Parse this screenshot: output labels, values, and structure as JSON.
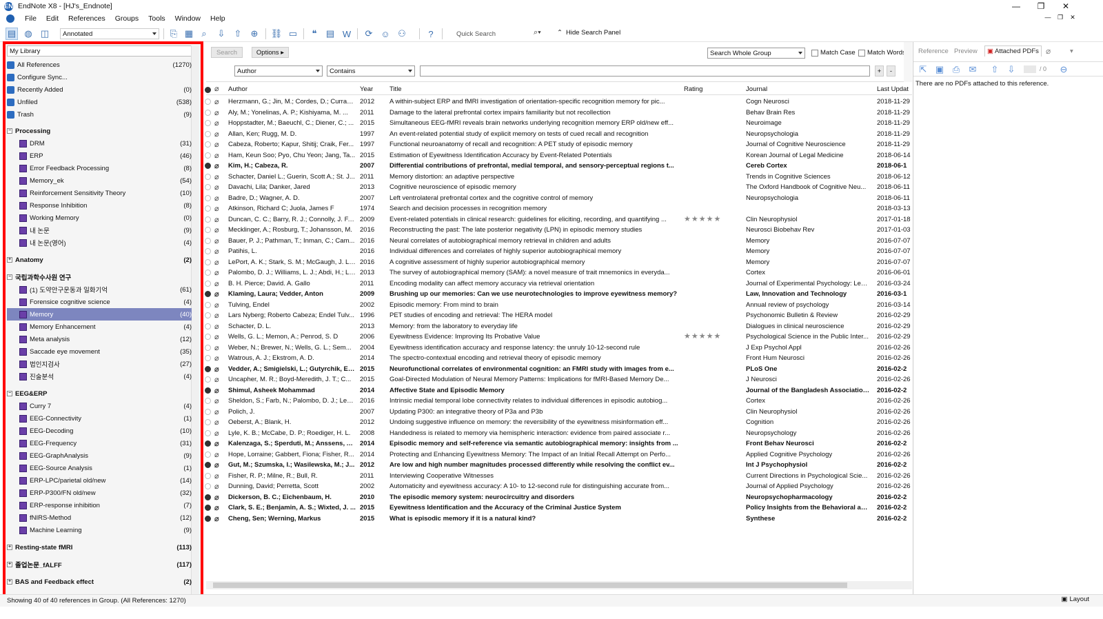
{
  "window": {
    "title": "EndNote X8 - [HJ's_Endnote]",
    "app_icon": "EN"
  },
  "window_controls": {
    "minimize": "—",
    "restore": "❐",
    "close": "✕"
  },
  "menu": [
    "File",
    "Edit",
    "References",
    "Groups",
    "Tools",
    "Window",
    "Help"
  ],
  "toolbar": {
    "style_value": "Annotated",
    "quick_search_placeholder": "Quick Search",
    "hide_search_label": "Hide Search Panel"
  },
  "library": {
    "header": "My Library",
    "items": [
      {
        "label": "All References",
        "count": "(1270)",
        "icon": "all-references-icon"
      },
      {
        "label": "Configure Sync...",
        "count": "",
        "icon": "sync-icon"
      },
      {
        "label": "Recently Added",
        "count": "(0)",
        "icon": "clock-icon"
      },
      {
        "label": "Unfiled",
        "count": "(538)",
        "icon": "unfiled-icon"
      },
      {
        "label": "Trash",
        "count": "(9)",
        "icon": "trash-icon"
      }
    ],
    "group_sets": [
      {
        "name": "Processing",
        "expanded": true,
        "groups": [
          {
            "label": "DRM",
            "count": "(31)"
          },
          {
            "label": "ERP",
            "count": "(46)"
          },
          {
            "label": "Error Feedback Processing",
            "count": "(8)"
          },
          {
            "label": "Memory_ek",
            "count": "(54)"
          },
          {
            "label": "Reinforcement Sensitivity Theory",
            "count": "(10)"
          },
          {
            "label": "Response Inhibition",
            "count": "(8)"
          },
          {
            "label": "Working Memory",
            "count": "(0)"
          },
          {
            "label": "내 논문",
            "count": "(9)"
          },
          {
            "label": "내 논문(영어)",
            "count": "(4)"
          }
        ]
      },
      {
        "name": "Anatomy",
        "expanded": false,
        "count": "(2)",
        "groups": []
      },
      {
        "name": "국립과학수사원 연구",
        "expanded": true,
        "groups": [
          {
            "label": "(1) 도약안구운동과 일화기억",
            "count": "(61)"
          },
          {
            "label": "Forensice cognitive science",
            "count": "(4)"
          },
          {
            "label": "Memory",
            "count": "(40)",
            "selected": true
          },
          {
            "label": "Memory Enhancement",
            "count": "(4)"
          },
          {
            "label": "Meta analysis",
            "count": "(12)"
          },
          {
            "label": "Saccade eye movement",
            "count": "(35)"
          },
          {
            "label": "법인지검사",
            "count": "(27)"
          },
          {
            "label": "진술분석",
            "count": "(4)"
          }
        ]
      },
      {
        "name": "EEG&ERP",
        "expanded": true,
        "groups": [
          {
            "label": "Curry 7",
            "count": "(4)"
          },
          {
            "label": "EEG-Connectivity",
            "count": "(1)"
          },
          {
            "label": "EEG-Decoding",
            "count": "(10)"
          },
          {
            "label": "EEG-Frequency",
            "count": "(31)"
          },
          {
            "label": "EEG-GraphAnalysis",
            "count": "(9)"
          },
          {
            "label": "EEG-Source Analysis",
            "count": "(1)"
          },
          {
            "label": "ERP-LPC/parietal old/new",
            "count": "(14)"
          },
          {
            "label": "ERP-P300/FN old/new",
            "count": "(32)"
          },
          {
            "label": "ERP-response inhibition",
            "count": "(7)"
          },
          {
            "label": "fNIRS-Method",
            "count": "(12)"
          },
          {
            "label": "Machine Learning",
            "count": "(9)"
          }
        ]
      },
      {
        "name": "Resting-state fMRI",
        "expanded": false,
        "count": "(113)",
        "groups": []
      },
      {
        "name": "졸업논문_fALFF",
        "expanded": false,
        "count": "(117)",
        "groups": []
      },
      {
        "name": "BAS and Feedback effect",
        "expanded": false,
        "count": "(2)",
        "groups": []
      }
    ]
  },
  "search_panel": {
    "search_label": "Search",
    "options_label": "Options ▸",
    "scope_value": "Search Whole Group",
    "match_case": "Match Case",
    "match_words": "Match Words",
    "field_value": "Author",
    "operator_value": "Contains",
    "plus": "+",
    "minus": "-"
  },
  "columns": {
    "author": "Author",
    "year": "Year",
    "title": "Title",
    "rating": "Rating",
    "journal": "Journal",
    "updated": "Last Updat"
  },
  "references": [
    {
      "author": "Herzmann, G.; Jin, M.; Cordes, D.; Curran...",
      "year": "2012",
      "title": "A within-subject ERP and fMRI investigation of orientation-specific recognition memory for pic...",
      "rating": "",
      "journal": "Cogn Neurosci",
      "updated": "2018-11-29",
      "bold": false
    },
    {
      "author": "Aly, M.; Yonelinas, A. P.; Kishiyama, M. ...",
      "year": "2011",
      "title": "Damage to the lateral prefrontal cortex impairs familiarity but not recollection",
      "rating": "",
      "journal": "Behav Brain Res",
      "updated": "2018-11-29",
      "bold": false
    },
    {
      "author": "Hoppstadter, M.; Baeuchl, C.; Diener, C.; ...",
      "year": "2015",
      "title": "Simultaneous EEG-fMRI reveals brain networks underlying recognition memory ERP old/new eff...",
      "rating": "",
      "journal": "Neuroimage",
      "updated": "2018-11-29",
      "bold": false
    },
    {
      "author": "Allan, Ken; Rugg, M. D.",
      "year": "1997",
      "title": "An event-related potential study of explicit memory on tests of cued recall and recognition",
      "rating": "",
      "journal": "Neuropsychologia",
      "updated": "2018-11-29",
      "bold": false
    },
    {
      "author": "Cabeza, Roberto; Kapur, Shitij; Craik, Fer...",
      "year": "1997",
      "title": "Functional neuroanatomy of recall and recognition: A PET study of episodic memory",
      "rating": "",
      "journal": "Journal of Cognitive Neuroscience",
      "updated": "2018-11-29",
      "bold": false
    },
    {
      "author": "Ham, Keun Soo; Pyo, Chu Yeon; Jang, Ta...",
      "year": "2015",
      "title": "Estimation of Eyewitness Identification Accuracy by Event-Related Potentials",
      "rating": "",
      "journal": "Korean Journal of Legal Medicine",
      "updated": "2018-06-14",
      "bold": false
    },
    {
      "author": "Kim, H.; Cabeza, R.",
      "year": "2007",
      "title": "Differential contributions of prefrontal, medial temporal, and sensory-perceptual regions t...",
      "rating": "",
      "journal": "Cereb Cortex",
      "updated": "2018-06-1",
      "bold": true
    },
    {
      "author": "Schacter, Daniel L.; Guerin, Scott A.; St. J...",
      "year": "2011",
      "title": "Memory distortion: an adaptive perspective",
      "rating": "",
      "journal": "Trends in Cognitive Sciences",
      "updated": "2018-06-12",
      "bold": false
    },
    {
      "author": "Davachi, Lila; Danker, Jared",
      "year": "2013",
      "title": "Cognitive neuroscience of episodic memory",
      "rating": "",
      "journal": "The Oxford Handbook of Cognitive Neu...",
      "updated": "2018-06-11",
      "bold": false
    },
    {
      "author": "Badre, D.; Wagner, A. D.",
      "year": "2007",
      "title": "Left ventrolateral prefrontal cortex and the cognitive control of memory",
      "rating": "",
      "journal": "Neuropsychologia",
      "updated": "2018-06-11",
      "bold": false
    },
    {
      "author": "Atkinson, Richard C; Juola, James F",
      "year": "1974",
      "title": "Search and decision processes in recognition memory",
      "rating": "",
      "journal": "",
      "updated": "2018-03-13",
      "bold": false
    },
    {
      "author": "Duncan, C. C.; Barry, R. J.; Connolly, J. F.;...",
      "year": "2009",
      "title": "Event-related potentials in clinical research: guidelines for eliciting, recording, and quantifying ...",
      "rating": "★★★★★",
      "journal": "Clin Neurophysiol",
      "updated": "2017-01-18",
      "bold": false
    },
    {
      "author": "Mecklinger, A.; Rosburg, T.; Johansson, M.",
      "year": "2016",
      "title": "Reconstructing the past: The late posterior negativity (LPN) in episodic memory studies",
      "rating": "",
      "journal": "Neurosci Biobehav Rev",
      "updated": "2017-01-03",
      "bold": false
    },
    {
      "author": "Bauer, P. J.; Pathman, T.; Inman, C.; Cam...",
      "year": "2016",
      "title": "Neural correlates of autobiographical memory retrieval in children and adults",
      "rating": "",
      "journal": "Memory",
      "updated": "2016-07-07",
      "bold": false
    },
    {
      "author": "Patihis, L.",
      "year": "2016",
      "title": "Individual differences and correlates of highly superior autobiographical memory",
      "rating": "",
      "journal": "Memory",
      "updated": "2016-07-07",
      "bold": false
    },
    {
      "author": "LePort, A. K.; Stark, S. M.; McGaugh, J. L.;...",
      "year": "2016",
      "title": "A cognitive assessment of highly superior autobiographical memory",
      "rating": "",
      "journal": "Memory",
      "updated": "2016-07-07",
      "bold": false
    },
    {
      "author": "Palombo, D. J.; Williams, L. J.; Abdi, H.; Le...",
      "year": "2013",
      "title": "The survey of autobiographical memory (SAM): a novel measure of trait mnemonics in everyda...",
      "rating": "",
      "journal": "Cortex",
      "updated": "2016-06-01",
      "bold": false
    },
    {
      "author": "B. H. Pierce; David. A. Gallo",
      "year": "2011",
      "title": "Encoding modality can affect memory accuracy via retrieval orientation",
      "rating": "",
      "journal": "Journal of Experimental Psychology: Lea...",
      "updated": "2016-03-24",
      "bold": false
    },
    {
      "author": "Klaming, Laura; Vedder, Anton",
      "year": "2009",
      "title": "Brushing up our memories: Can we use neurotechnologies to improve eyewitness memory?",
      "rating": "",
      "journal": "Law, Innovation and Technology",
      "updated": "2016-03-1",
      "bold": true
    },
    {
      "author": "Tulving, Endel",
      "year": "2002",
      "title": "Episodic memory: From mind to brain",
      "rating": "",
      "journal": "Annual review of psychology",
      "updated": "2016-03-14",
      "bold": false
    },
    {
      "author": "Lars Nyberg; Roberto Cabeza; Endel Tulv...",
      "year": "1996",
      "title": "PET studies of encoding and retrieval: The HERA model",
      "rating": "",
      "journal": "Psychonomic Bulletin & Review",
      "updated": "2016-02-29",
      "bold": false
    },
    {
      "author": "Schacter, D. L.",
      "year": "2013",
      "title": "Memory: from the laboratory to everyday life",
      "rating": "",
      "journal": "Dialogues in clinical neuroscience",
      "updated": "2016-02-29",
      "bold": false
    },
    {
      "author": "Wells, G. L.; Memon, A.; Penrod, S. D",
      "year": "2006",
      "title": "Eyewitness Evidence: Improving Its Probative Value",
      "rating": "★★★★★",
      "journal": "Psychological Science in the Public Inter...",
      "updated": "2016-02-29",
      "bold": false
    },
    {
      "author": "Weber, N.; Brewer, N.; Wells, G. L.; Sem...",
      "year": "2004",
      "title": "Eyewitness identification accuracy and response latency: the unruly 10-12-second rule",
      "rating": "",
      "journal": "J Exp Psychol Appl",
      "updated": "2016-02-26",
      "bold": false
    },
    {
      "author": "Watrous, A. J.; Ekstrom, A. D.",
      "year": "2014",
      "title": "The spectro-contextual encoding and retrieval theory of episodic memory",
      "rating": "",
      "journal": "Front Hum Neurosci",
      "updated": "2016-02-26",
      "bold": false
    },
    {
      "author": "Vedder, A.; Smigielski, L.; Gutyrchik, E.;...",
      "year": "2015",
      "title": "Neurofunctional correlates of environmental cognition: an FMRI study with images from e...",
      "rating": "",
      "journal": "PLoS One",
      "updated": "2016-02-2",
      "bold": true
    },
    {
      "author": "Uncapher, M. R.; Boyd-Meredith, J. T.; C...",
      "year": "2015",
      "title": "Goal-Directed Modulation of Neural Memory Patterns: Implications for fMRI-Based Memory De...",
      "rating": "",
      "journal": "J Neurosci",
      "updated": "2016-02-26",
      "bold": false
    },
    {
      "author": "Shimul, Asheek Mohammad",
      "year": "2014",
      "title": "Affective State and Episodic Memory",
      "rating": "",
      "journal": "Journal of the Bangladesh Association ...",
      "updated": "2016-02-2",
      "bold": true
    },
    {
      "author": "Sheldon, S.; Farb, N.; Palombo, D. J.; Levi...",
      "year": "2016",
      "title": "Intrinsic medial temporal lobe connectivity relates to individual differences in episodic autobiog...",
      "rating": "",
      "journal": "Cortex",
      "updated": "2016-02-26",
      "bold": false
    },
    {
      "author": "Polich, J.",
      "year": "2007",
      "title": "Updating P300: an integrative theory of P3a and P3b",
      "rating": "",
      "journal": "Clin Neurophysiol",
      "updated": "2016-02-26",
      "bold": false
    },
    {
      "author": "Oeberst, A.; Blank, H.",
      "year": "2012",
      "title": "Undoing suggestive influence on memory: the reversibility of the eyewitness misinformation eff...",
      "rating": "",
      "journal": "Cognition",
      "updated": "2016-02-26",
      "bold": false
    },
    {
      "author": "Lyle, K. B.; McCabe, D. P.; Roediger, H. L.",
      "year": "2008",
      "title": "Handedness is related to memory via hemispheric interaction: evidence from paired associate r...",
      "rating": "",
      "journal": "Neuropsychology",
      "updated": "2016-02-26",
      "bold": false
    },
    {
      "author": "Kalenzaga, S.; Sperduti, M.; Anssens, A....",
      "year": "2014",
      "title": "Episodic memory and self-reference via semantic autobiographical memory: insights from ...",
      "rating": "",
      "journal": "Front Behav Neurosci",
      "updated": "2016-02-2",
      "bold": true
    },
    {
      "author": "Hope, Lorraine; Gabbert, Fiona; Fisher, R...",
      "year": "2014",
      "title": "Protecting and Enhancing Eyewitness Memory: The Impact of an Initial Recall Attempt on Perfo...",
      "rating": "",
      "journal": "Applied Cognitive Psychology",
      "updated": "2016-02-26",
      "bold": false
    },
    {
      "author": "Gut, M.; Szumska, I.; Wasilewska, M.; J...",
      "year": "2012",
      "title": "Are low and high number magnitudes processed differently while resolving the conflict ev...",
      "rating": "",
      "journal": "Int J Psychophysiol",
      "updated": "2016-02-2",
      "bold": true
    },
    {
      "author": "Fisher, R. P.; Milne, R.; Bull, R.",
      "year": "2011",
      "title": "Interviewing Cooperative Witnesses",
      "rating": "",
      "journal": "Current Directions in Psychological Scie...",
      "updated": "2016-02-26",
      "bold": false
    },
    {
      "author": "Dunning, David; Perretta, Scott",
      "year": "2002",
      "title": "Automaticity and eyewitness accuracy: A 10- to 12-second rule for distinguishing accurate from...",
      "rating": "",
      "journal": "Journal of Applied Psychology",
      "updated": "2016-02-26",
      "bold": false
    },
    {
      "author": "Dickerson, B. C.; Eichenbaum, H.",
      "year": "2010",
      "title": "The episodic memory system: neurocircuitry and disorders",
      "rating": "",
      "journal": "Neuropsychopharmacology",
      "updated": "2016-02-2",
      "bold": true
    },
    {
      "author": "Clark, S. E.; Benjamin, A. S.; Wixted, J. ...",
      "year": "2015",
      "title": "Eyewitness Identification and the Accuracy of the Criminal Justice System",
      "rating": "",
      "journal": "Policy Insights from the Behavioral an...",
      "updated": "2016-02-2",
      "bold": true
    },
    {
      "author": "Cheng, Sen; Werning, Markus",
      "year": "2015",
      "title": "What is episodic memory if it is a natural kind?",
      "rating": "",
      "journal": "Synthese",
      "updated": "2016-02-2",
      "bold": true
    }
  ],
  "right_panel": {
    "tabs": [
      "Reference",
      "Preview",
      "Attached PDFs"
    ],
    "page_counter": "/ 0",
    "message": "There are no PDFs attached to this reference."
  },
  "status": {
    "text": "Showing 40 of 40 references in Group. (All References: 1270)",
    "layout_label": "Layout"
  },
  "colors": {
    "selection": "#7d86bf",
    "highlight_border": "#ff0000",
    "group_icon": "#6a3fa8",
    "toolbar_icon": "#3a6fb0"
  }
}
